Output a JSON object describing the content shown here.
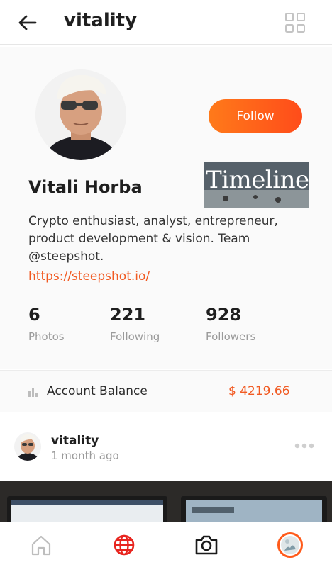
{
  "header": {
    "title": "vitality"
  },
  "profile": {
    "follow_label": "Follow",
    "timeline_label": "Timeline",
    "name": "Vitali Horba",
    "bio": "Crypto enthusiast, analyst, entrepreneur, product development & vision. Team @steepshot.",
    "link": "https://steepshot.io/"
  },
  "stats": [
    {
      "value": "6",
      "label": "Photos"
    },
    {
      "value": "221",
      "label": "Following"
    },
    {
      "value": "928",
      "label": "Followers"
    }
  ],
  "balance": {
    "label": "Account Balance",
    "value": "$ 4219.66"
  },
  "post": {
    "username": "vitality",
    "time": "1 month ago"
  },
  "nav": {
    "items": [
      "home-icon",
      "globe-icon",
      "camera-icon",
      "profile-avatar"
    ]
  },
  "colors": {
    "accent": "#f15a22",
    "follow_gradient_start": "#ff7a1a",
    "follow_gradient_end": "#ff4c1a",
    "muted": "#9a9a9a"
  }
}
